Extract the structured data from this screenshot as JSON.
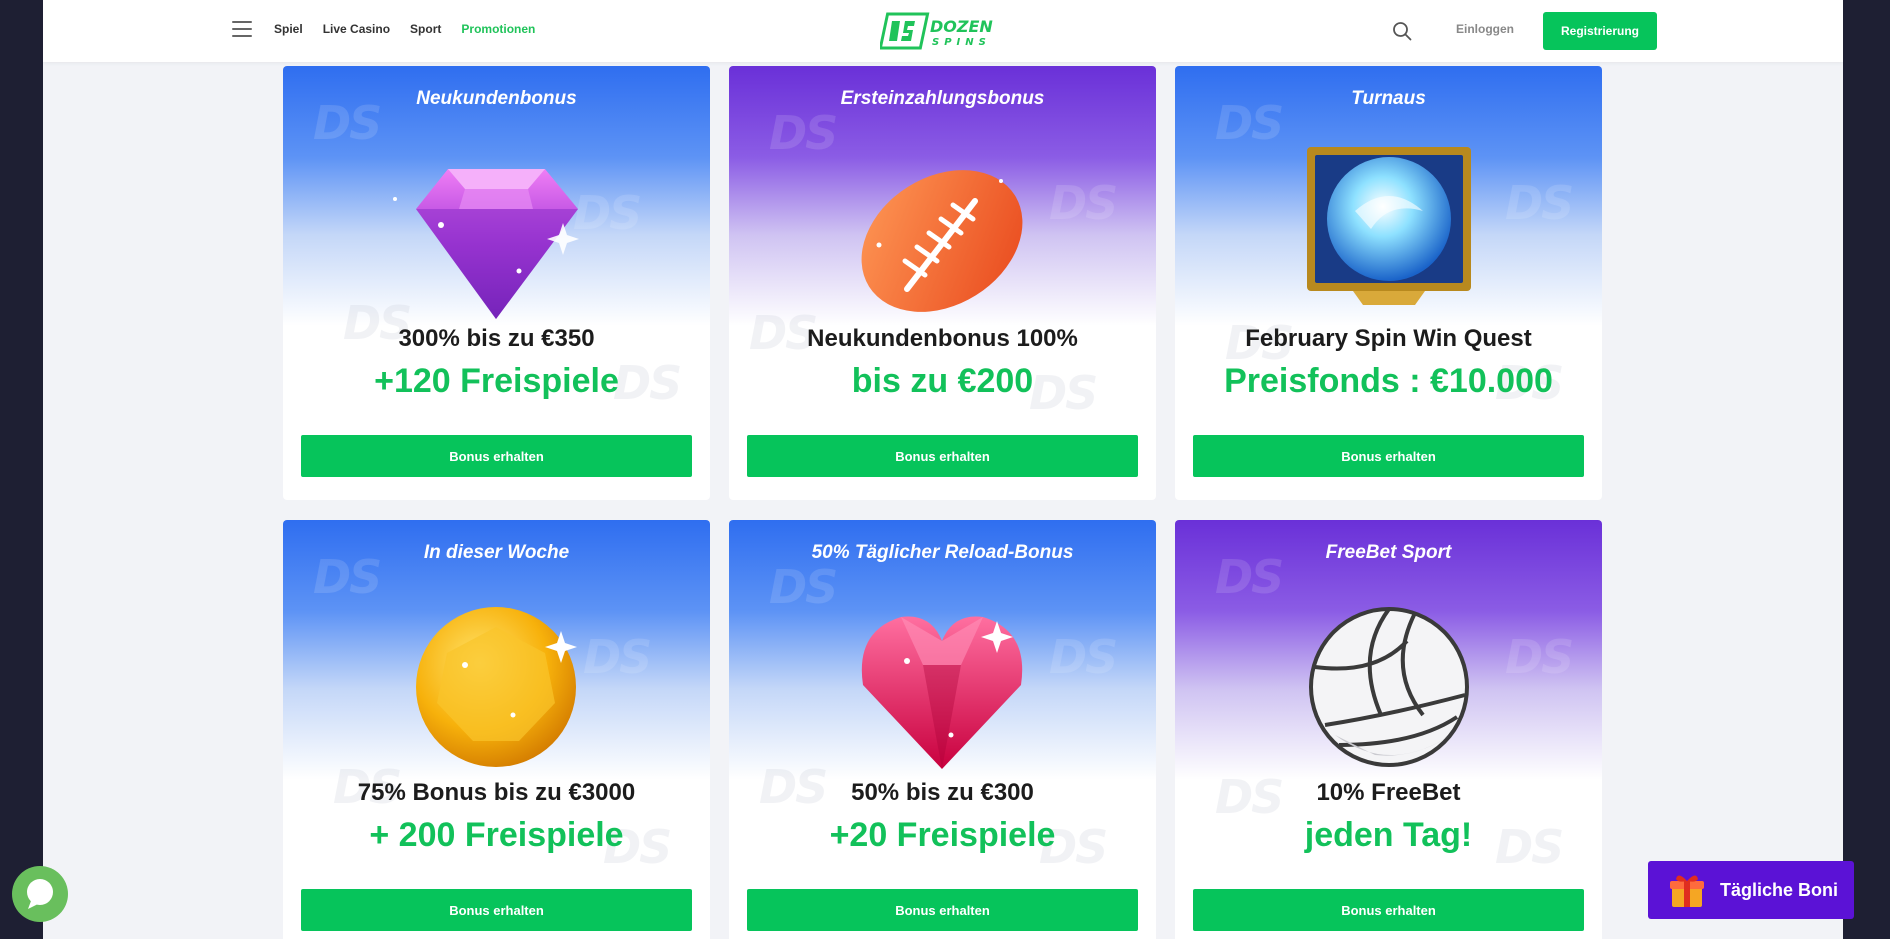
{
  "header": {
    "nav": [
      {
        "label": "Spiel",
        "active": false
      },
      {
        "label": "Live Casino",
        "active": false
      },
      {
        "label": "Sport",
        "active": false
      },
      {
        "label": "Promotionen",
        "active": true
      }
    ],
    "logo_text": "DOZEN SPINS",
    "login_label": "Einloggen",
    "register_label": "Registrierung"
  },
  "colors": {
    "accent": "#06c45b",
    "accent_text": "#12c15a",
    "blue_header": "#2f6ef0",
    "purple_header": "#6a30d8",
    "daily_button": "#5b12d6"
  },
  "cards": [
    {
      "title": "Neukundenbonus",
      "line1": "300% bis zu €350",
      "line2": "+120 Freispiele",
      "button": "Bonus erhalten",
      "theme": "blue",
      "art": "purple-gem-icon"
    },
    {
      "title": "Ersteinzahlungsbonus",
      "line1": "Neukundenbonus 100%",
      "line2": "bis zu €200",
      "button": "Bonus erhalten",
      "theme": "purple",
      "art": "football-icon"
    },
    {
      "title": "Turnaus",
      "line1": "February Spin Win Quest",
      "line2": "Preisfonds : €10.000",
      "button": "Bonus erhalten",
      "theme": "blue",
      "art": "crystal-orb-icon"
    },
    {
      "title": "In dieser Woche",
      "line1": "75% Bonus bis zu €3000",
      "line2": "+ 200 Freispiele",
      "button": "Bonus erhalten",
      "theme": "blue",
      "art": "gold-gem-icon"
    },
    {
      "title": "50% Täglicher Reload-Bonus",
      "line1": "50% bis zu €300",
      "line2": "+20 Freispiele",
      "button": "Bonus erhalten",
      "theme": "blue",
      "art": "heart-gem-icon"
    },
    {
      "title": "FreeBet Sport",
      "line1": "10% FreeBet",
      "line2": "jeden Tag!",
      "button": "Bonus erhalten",
      "theme": "purple",
      "art": "volleyball-icon"
    }
  ],
  "daily_bonus_label": "Tägliche Boni"
}
